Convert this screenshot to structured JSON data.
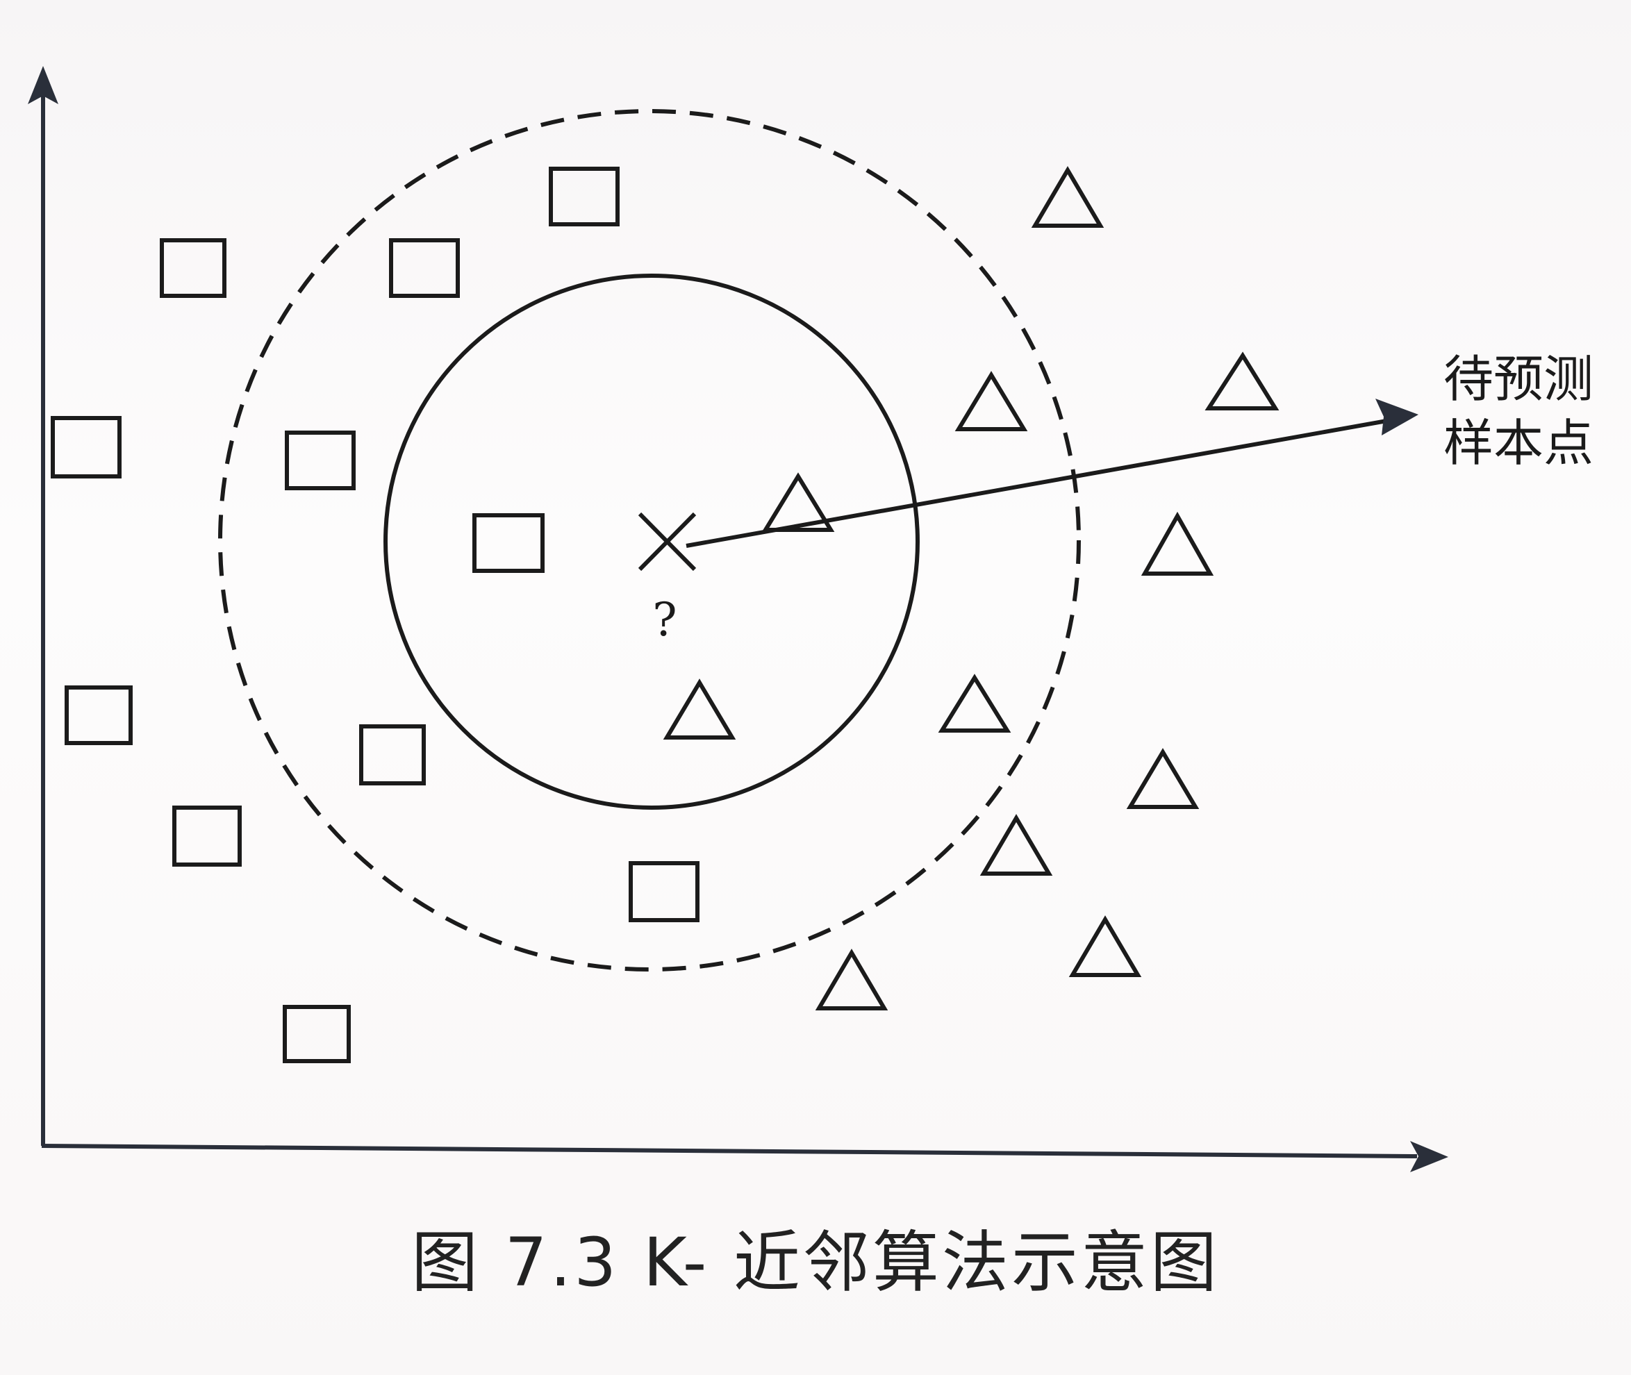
{
  "figure": {
    "caption": "图 7.3   K- 近邻算法示意图",
    "query_label": "?",
    "annotation_lines": [
      "待预测",
      "样本点"
    ]
  },
  "legend_free_classes": {
    "class_a_shape": "square",
    "class_b_shape": "triangle",
    "query_marker_shape": "cross"
  },
  "colors": {
    "ink": "#1b1b1b",
    "axis": "#2a2f3a",
    "paper": "#fbfafa"
  }
}
